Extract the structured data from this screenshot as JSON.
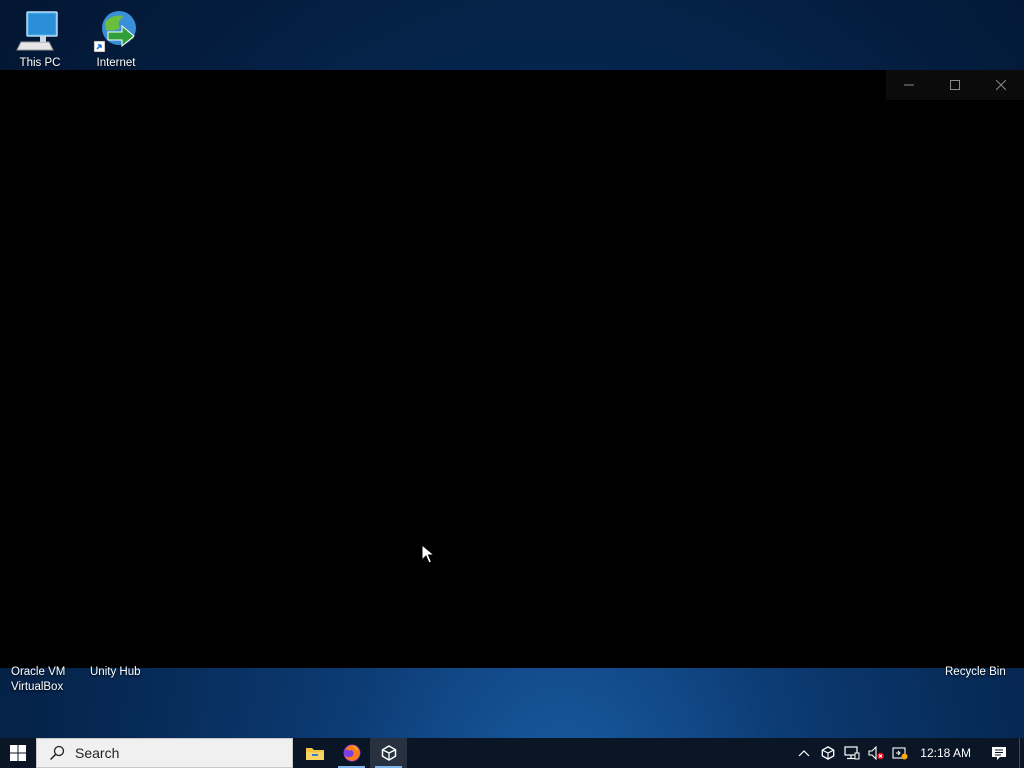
{
  "desktop": {
    "top_icons": [
      {
        "label": "This PC",
        "icon": "this-pc-icon"
      },
      {
        "label": "Internet",
        "icon": "internet-download-manager-icon"
      }
    ],
    "bottom_labels": {
      "virtualbox": "Oracle VM\nVirtualBox",
      "unity_hub": "Unity Hub",
      "recycle_bin": "Recycle Bin"
    }
  },
  "window": {
    "controls": [
      "minimize-icon",
      "maximize-icon",
      "close-icon"
    ]
  },
  "taskbar": {
    "start_icon": "windows-logo-icon",
    "search_placeholder": "Search",
    "pinned_apps": [
      {
        "name": "File Explorer",
        "icon": "folder-icon",
        "running": false
      },
      {
        "name": "Firefox",
        "icon": "firefox-icon",
        "running": true
      },
      {
        "name": "Unity",
        "icon": "unity-icon",
        "running": true,
        "active": true
      }
    ],
    "tray": {
      "icons": [
        "chevron-up-icon",
        "unity-tray-icon",
        "network-icon",
        "volume-muted-icon",
        "action-badge-icon"
      ],
      "time": "12:18 AM",
      "notification_icon": "notification-center-icon"
    }
  },
  "colors": {
    "taskbar": "#0a1526",
    "window_bg": "#000000",
    "accent_underline": "#7fb4ea"
  }
}
